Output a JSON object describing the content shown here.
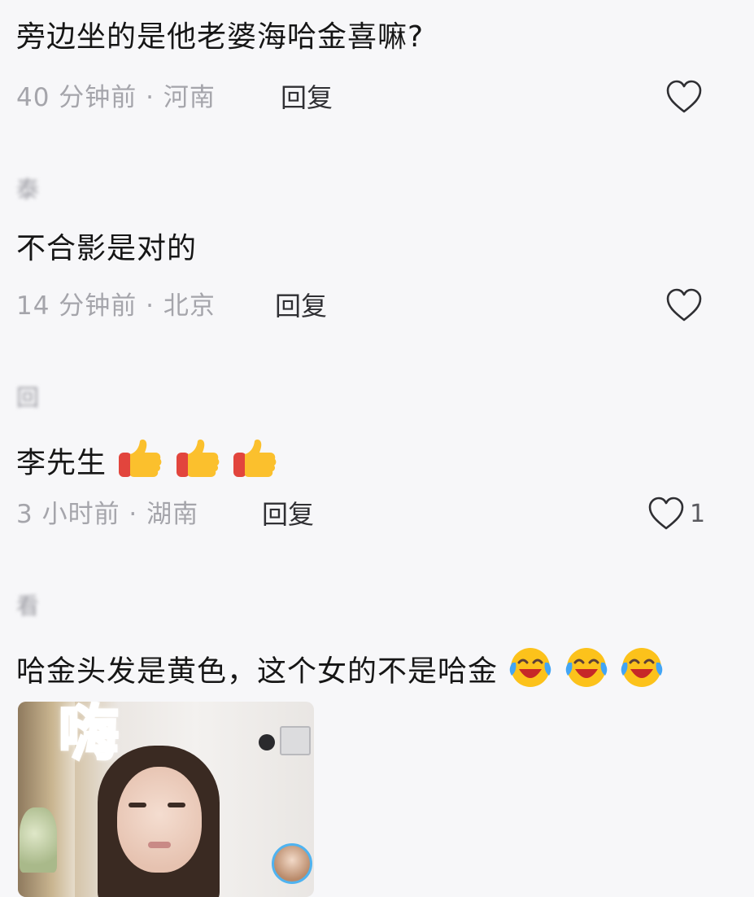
{
  "comments": [
    {
      "username": "",
      "text": "旁边坐的是他老婆海哈金喜嘛?",
      "time_location": "40 分钟前 · 河南",
      "reply_label": "回复",
      "likes": ""
    },
    {
      "username": "泰",
      "text": "不合影是对的",
      "time_location": "14 分钟前 · 北京",
      "reply_label": "回复",
      "likes": ""
    },
    {
      "username": "回",
      "text": "李先生",
      "emoji": "thumbs-up-icon",
      "emoji_count": 3,
      "time_location": "3 小时前 · 湖南",
      "reply_label": "回复",
      "likes": "1"
    },
    {
      "username": "看",
      "text": "哈金头发是黄色，这个女的不是哈金",
      "emoji": "laughing-crying-icon",
      "emoji_count": 3,
      "time_location": "",
      "reply_label": "",
      "likes": ""
    }
  ],
  "preview": {
    "overlay_text": "嗨"
  },
  "colors": {
    "background": "#f7f7f9",
    "meta_text": "#a5a5ab",
    "reply_text": "#303034",
    "preview_overlay_text": "#3fa0e6"
  }
}
